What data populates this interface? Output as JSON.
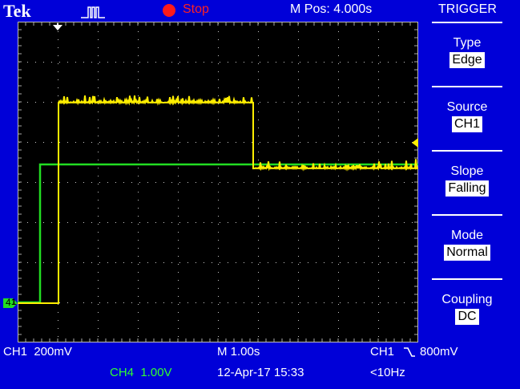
{
  "header": {
    "brand": "Tek",
    "status": "Stop",
    "m_pos": "M Pos: 4.000s",
    "menu_title": "TRIGGER"
  },
  "menu": {
    "items": [
      {
        "label": "Type",
        "value": "Edge"
      },
      {
        "label": "Source",
        "value": "CH1"
      },
      {
        "label": "Slope",
        "value": "Falling"
      },
      {
        "label": "Mode",
        "value": "Normal"
      },
      {
        "label": "Coupling",
        "value": "DC"
      }
    ]
  },
  "readouts": {
    "ch1_scale": "CH1  200mV",
    "ch4_scale": "CH4  1.00V",
    "time_scale": "M 1.00s",
    "date_time": "12-Apr-17 15:33",
    "trigger_source": "CH1",
    "trigger_level": "800mV",
    "trigger_freq": "<10Hz"
  },
  "channel_markers": {
    "ch1": "1",
    "ch4": "4"
  },
  "colors": {
    "background": "#0000d8",
    "ch1": "#ffee00",
    "ch4": "#22dd22",
    "status": "#ff1a1a"
  }
}
